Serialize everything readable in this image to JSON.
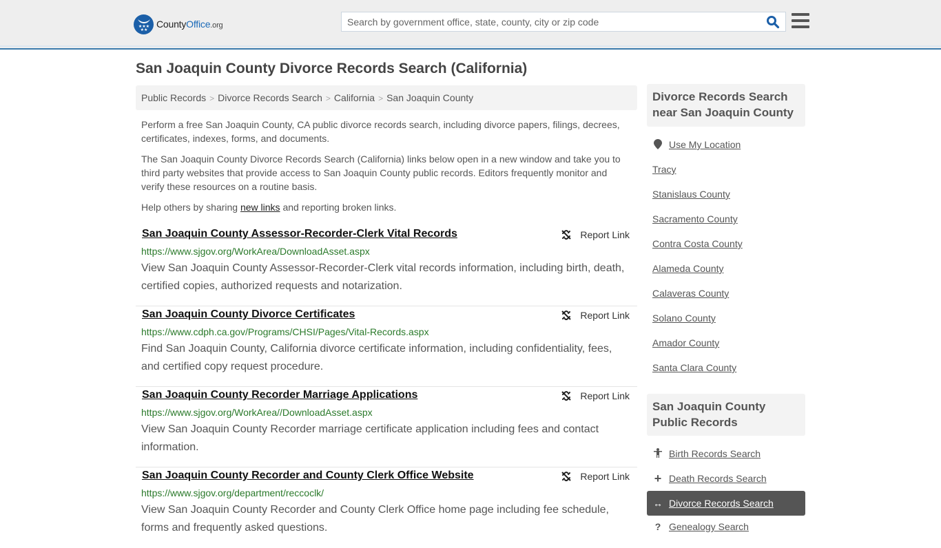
{
  "header": {
    "logo": {
      "part1": "County",
      "part2": "Office",
      "part3": ".org"
    },
    "search": {
      "placeholder": "Search by government office, state, county, city or zip code",
      "value": ""
    },
    "brand_color": "#1b5fa8",
    "accent_bar_color": "#3a7aab"
  },
  "main": {
    "title": "San Joaquin County Divorce Records Search (California)",
    "breadcrumb": [
      "Public Records",
      "Divorce Records Search",
      "California",
      "San Joaquin County"
    ],
    "intro": {
      "p1": "Perform a free San Joaquin County, CA public divorce records search, including divorce papers, filings, decrees, certificates, indexes, forms, and documents.",
      "p2": "The San Joaquin County Divorce Records Search (California) links below open in a new window and take you to third party websites that provide access to San Joaquin County public records. Editors frequently monitor and verify these resources on a routine basis.",
      "p3_before": "Help others by sharing ",
      "p3_link": "new links",
      "p3_after": " and reporting broken links."
    },
    "report_label": "Report Link",
    "results": [
      {
        "title": "San Joaquin County Assessor-Recorder-Clerk Vital Records",
        "url": "https://www.sjgov.org/WorkArea/DownloadAsset.aspx",
        "description": "View San Joaquin County Assessor-Recorder-Clerk vital records information, including birth, death, certified copies, authorized requests and notarization."
      },
      {
        "title": "San Joaquin County Divorce Certificates",
        "url": "https://www.cdph.ca.gov/Programs/CHSI/Pages/Vital-Records.aspx",
        "description": "Find San Joaquin County, California divorce certificate information, including confidentiality, fees, and certified copy request procedure."
      },
      {
        "title": "San Joaquin County Recorder Marriage Applications",
        "url": "https://www.sjgov.org/WorkArea//DownloadAsset.aspx",
        "description": "View San Joaquin County Recorder marriage certificate application including fees and contact information."
      },
      {
        "title": "San Joaquin County Recorder and County Clerk Office Website",
        "url": "https://www.sjgov.org/department/reccoclk/",
        "description": "View San Joaquin County Recorder and County Clerk Office home page including fee schedule, forms and frequently asked questions."
      }
    ]
  },
  "sidebar": {
    "nearby": {
      "heading": "Divorce Records Search near San Joaquin County",
      "use_location": "Use My Location",
      "items": [
        "Tracy",
        "Stanislaus County",
        "Sacramento County",
        "Contra Costa County",
        "Alameda County",
        "Calaveras County",
        "Solano County",
        "Amador County",
        "Santa Clara County"
      ]
    },
    "public_records": {
      "heading": "San Joaquin County Public Records",
      "items": [
        {
          "label": "Birth Records Search",
          "icon": "child-icon"
        },
        {
          "label": "Death Records Search",
          "icon": "plus-icon"
        },
        {
          "label": "Divorce Records Search",
          "icon": "arrows-h-icon",
          "active": true
        },
        {
          "label": "Genealogy Search",
          "icon": "question-icon"
        }
      ]
    }
  }
}
